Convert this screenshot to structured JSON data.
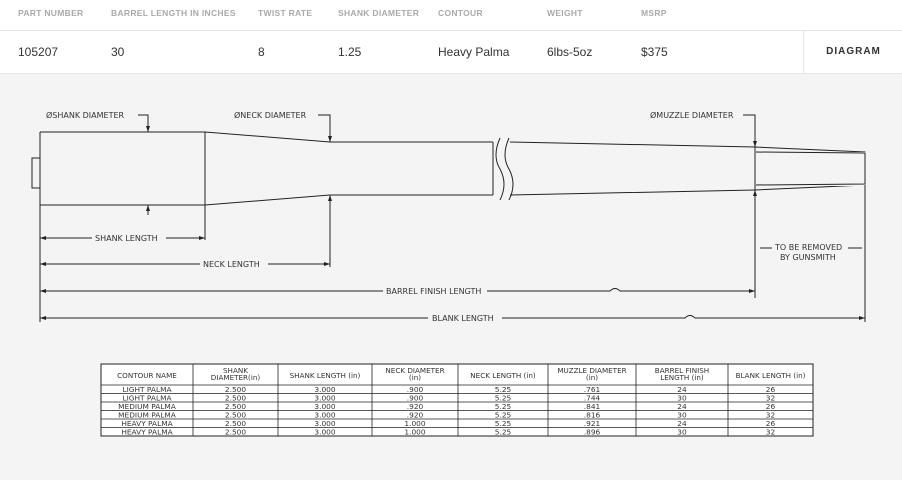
{
  "header": {
    "columns": [
      "PART NUMBER",
      "BARREL LENGTH IN INCHES",
      "TWIST RATE",
      "SHANK DIAMETER",
      "CONTOUR",
      "WEIGHT",
      "MSRP"
    ]
  },
  "product": {
    "part_number": "105207",
    "barrel_length": "30",
    "twist_rate": "8",
    "shank_diameter": "1.25",
    "contour": "Heavy Palma",
    "weight": "6lbs-5oz",
    "msrp": "$375",
    "diagram_label": "DIAGRAM"
  },
  "diagram": {
    "labels": {
      "shank_dia": "ØSHANK DIAMETER",
      "neck_dia": "ØNECK DIAMETER",
      "muzzle_dia": "ØMUZZLE DIAMETER",
      "shank_len": "SHANK LENGTH",
      "neck_len": "NECK LENGTH",
      "barrel_finish": "BARREL FINISH LENGTH",
      "blank_len": "BLANK LENGTH",
      "removed_1": "TO BE REMOVED",
      "removed_2": "BY GUNSMITH"
    }
  },
  "spec_table": {
    "headers": [
      [
        "CONTOUR NAME"
      ],
      [
        "SHANK",
        "DIAMETER(in)"
      ],
      [
        "SHANK LENGTH (in)"
      ],
      [
        "NECK DIAMETER",
        "(in)"
      ],
      [
        "NECK LENGTH (in)"
      ],
      [
        "MUZZLE DIAMETER",
        "(in)"
      ],
      [
        "BARREL FINISH",
        "LENGTH (in)"
      ],
      [
        "BLANK LENGTH (in)"
      ]
    ],
    "rows": [
      [
        "LIGHT PALMA",
        "2.500",
        "3.000",
        ".900",
        "5.25",
        ".761",
        "24",
        "26"
      ],
      [
        "LIGHT PALMA",
        "2.500",
        "3.000",
        ".900",
        "5.25",
        ".744",
        "30",
        "32"
      ],
      [
        "MEDIUM PALMA",
        "2.500",
        "3.000",
        ".920",
        "5.25",
        ".841",
        "24",
        "26"
      ],
      [
        "MEDIUM PALMA",
        "2.500",
        "3.000",
        ".920",
        "5.25",
        ".816",
        "30",
        "32"
      ],
      [
        "HEAVY PALMA",
        "2.500",
        "3.000",
        "1.000",
        "5.25",
        ".921",
        "24",
        "26"
      ],
      [
        "HEAVY PALMA",
        "2.500",
        "3.000",
        "1.000",
        "5.25",
        ".896",
        "30",
        "32"
      ]
    ]
  },
  "colors": {
    "line": "#222222",
    "header_text": "#a9a9a9",
    "background": "#f4f4f4"
  }
}
